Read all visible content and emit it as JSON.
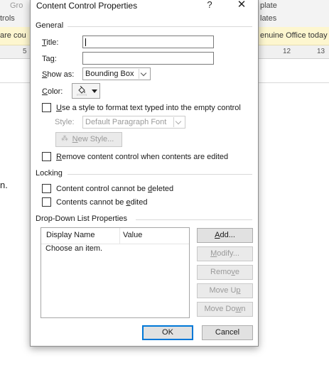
{
  "background": {
    "ribbon_fragment_left": "trols",
    "ribbon_fragment_top": "Gro",
    "ribbon_fragment_right_top": "plate",
    "ribbon_fragment_right_bottom": "lates",
    "info_bar_left": "are cou",
    "info_bar_right": "enuine Office today",
    "ruler_left": "5",
    "ruler_right_a": "12",
    "ruler_right_b": "13",
    "doc_fragment": "n."
  },
  "dialog": {
    "title": "Content Control Properties",
    "help_glyph": "?",
    "close_glyph": "✕",
    "general": {
      "group_label": "General",
      "title_label_first": "T",
      "title_label_rest": "itle:",
      "title_value": "",
      "tag_label_first": "Ta",
      "tag_label_u": "g",
      "tag_label_rest": ":",
      "tag_value": "",
      "show_as_label_first": "",
      "show_as_label_u": "S",
      "show_as_label_rest": "how as:",
      "show_as_value": "Bounding Box",
      "color_label_first": "C",
      "color_label_rest": "olor:",
      "use_style_label_u": "U",
      "use_style_label_rest": "se a style to format text typed into the empty control",
      "use_style_checked": false,
      "style_label": "Style:",
      "style_value": "Default Paragraph Font",
      "new_style_label_u": "N",
      "new_style_label_rest": "ew Style...",
      "remove_label_u": "R",
      "remove_label_rest": "emove content control when contents are edited",
      "remove_checked": false
    },
    "locking": {
      "group_label": "Locking",
      "cannot_delete_label_a": "Content control cannot be ",
      "cannot_delete_label_u": "d",
      "cannot_delete_label_b": "eleted",
      "cannot_delete_checked": false,
      "cannot_edit_label_a": "Contents cannot be ",
      "cannot_edit_label_u": "e",
      "cannot_edit_label_b": "dited",
      "cannot_edit_checked": false
    },
    "dropdown": {
      "group_label": "Drop-Down List Properties",
      "columns": [
        "Display Name",
        "Value"
      ],
      "rows": [
        {
          "display_name": "Choose an item.",
          "value": ""
        }
      ],
      "add_label_u": "A",
      "add_label_rest": "dd...",
      "modify_label_u": "M",
      "modify_label_rest": "odify...",
      "remove_label_a": "Remo",
      "remove_label_u": "v",
      "remove_label_b": "e",
      "move_up_label_a": "Move U",
      "move_up_label_u": "p",
      "move_down_label_a": "Move Do",
      "move_down_label_u": "w",
      "move_down_label_b": "n"
    },
    "ok_label": "OK",
    "cancel_label": "Cancel"
  }
}
